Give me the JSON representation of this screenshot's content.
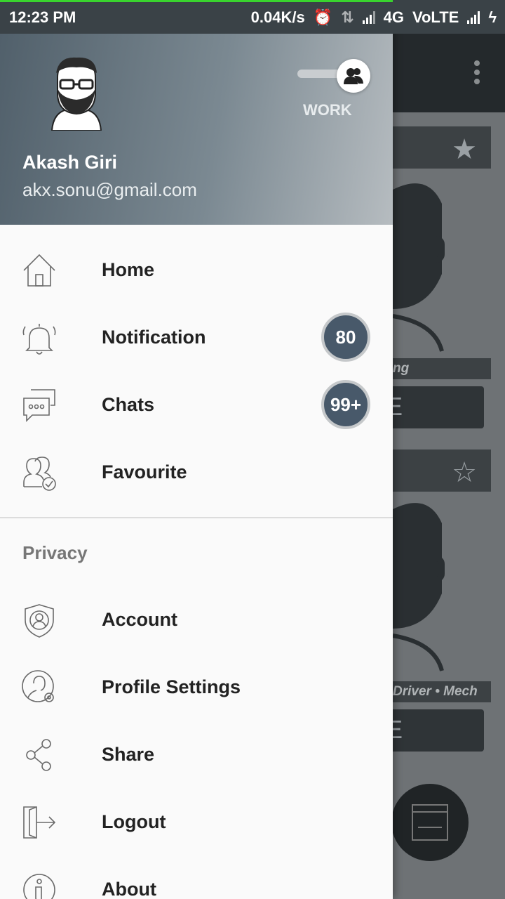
{
  "status_bar": {
    "time": "12:23 PM",
    "net_speed": "0.04K/s",
    "network": "4G",
    "volte": "VoLTE"
  },
  "header": {
    "user_name": "Akash Giri",
    "user_email": "akx.sonu@gmail.com",
    "mode_label": "WORK"
  },
  "menu": {
    "items": [
      {
        "label": "Home",
        "icon": "home-icon"
      },
      {
        "label": "Notification",
        "icon": "bell-icon",
        "badge": "80"
      },
      {
        "label": "Chats",
        "icon": "chat-icon",
        "badge": "99+"
      },
      {
        "label": "Favourite",
        "icon": "favourite-users-icon"
      }
    ],
    "privacy_title": "Privacy",
    "privacy_items": [
      {
        "label": "Account",
        "icon": "shield-user-icon"
      },
      {
        "label": "Profile Settings",
        "icon": "profile-settings-icon"
      },
      {
        "label": "Share",
        "icon": "share-icon"
      },
      {
        "label": "Logout",
        "icon": "logout-icon"
      },
      {
        "label": "About",
        "icon": "info-icon"
      }
    ]
  },
  "background": {
    "tag_1": "ng",
    "tag_2": "Driver  •  Mech",
    "button_1": "E",
    "button_2": "E"
  },
  "colors": {
    "header_start": "#51606b",
    "header_end": "#b6bcc0",
    "badge": "#48596a",
    "progress": "#39d42e"
  }
}
